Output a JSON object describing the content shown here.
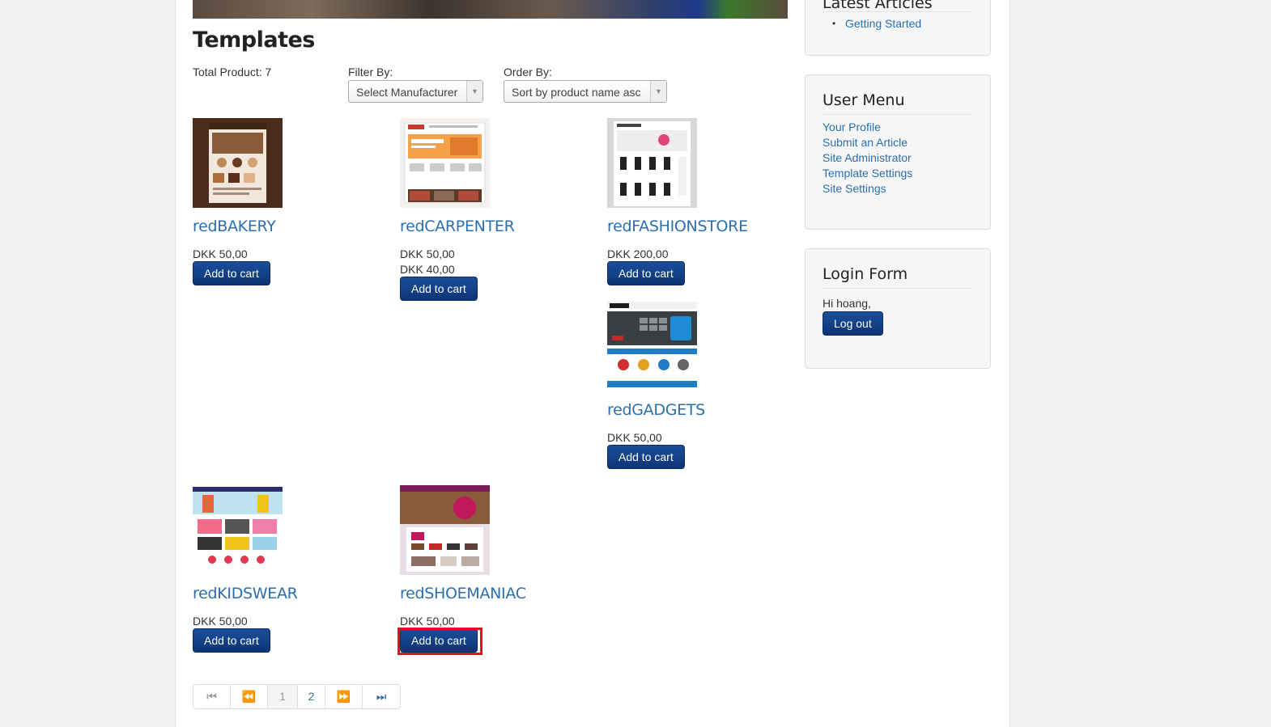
{
  "header": {
    "title": "Templates"
  },
  "toolbar": {
    "total_label": "Total Product: 7",
    "filter_label": "Filter By:",
    "filter_value": "Select Manufacturer",
    "order_label": "Order By:",
    "order_value": "Sort by product name asc"
  },
  "products": [
    {
      "name": "redBAKERY",
      "prices": [
        "DKK 50,00"
      ],
      "button": "Add to cart"
    },
    {
      "name": "redCARPENTER",
      "prices": [
        "DKK 50,00",
        "DKK 40,00"
      ],
      "button": "Add to cart"
    },
    {
      "name": "redFASHIONSTORE",
      "prices": [
        "DKK 200,00"
      ],
      "button": "Add to cart"
    },
    {
      "name": "redGADGETS",
      "prices": [
        "DKK 50,00"
      ],
      "button": "Add to cart"
    },
    {
      "name": "redKIDSWEAR",
      "prices": [
        "DKK 50,00"
      ],
      "button": "Add to cart"
    },
    {
      "name": "redSHOEMANIAC",
      "prices": [
        "DKK 50,00"
      ],
      "button": "Add to cart"
    }
  ],
  "pagination": {
    "first": "⏮",
    "prev": "⏪",
    "page1": "1",
    "page2": "2",
    "next": "⏩",
    "last": "⏭"
  },
  "sidebar": {
    "latest": {
      "title": "Latest Articles",
      "items": [
        "Getting Started"
      ]
    },
    "user_menu": {
      "title": "User Menu",
      "items": [
        "Your Profile",
        "Submit an Article",
        "Site Administrator",
        "Template Settings",
        "Site Settings"
      ]
    },
    "login": {
      "title": "Login Form",
      "greeting": "Hi hoang,",
      "logout": "Log out"
    }
  },
  "colors": {
    "accent": "#2a6fb0",
    "button": "#0d3476",
    "highlight": "#e3101d"
  }
}
